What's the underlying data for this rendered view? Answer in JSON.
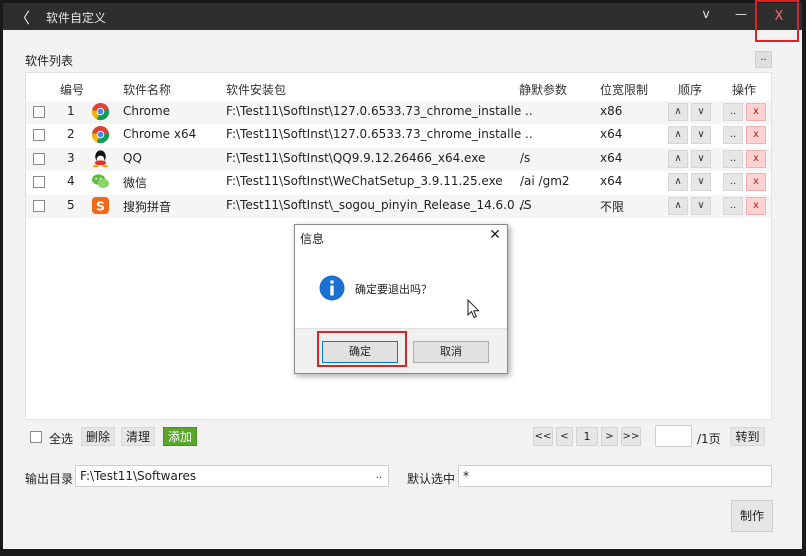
{
  "titlebar": {
    "back": "〈",
    "title": "软件自定义",
    "collapse": "v",
    "minimize": "—",
    "close": "X"
  },
  "list": {
    "title": "软件列表",
    "more": "..",
    "headers": {
      "no": "编号",
      "name": "软件名称",
      "package": "软件安装包",
      "silent": "静默参数",
      "arch": "位宽限制",
      "order": "顺序",
      "ops": "操作"
    },
    "rows": [
      {
        "no": "1",
        "icon": "chrome-icon",
        "name": "Chrome",
        "package": "F:\\Test11\\SoftInst\\127.0.6533.73_chrome_installe ..",
        "silent": "",
        "arch": "x86"
      },
      {
        "no": "2",
        "icon": "chrome-icon",
        "name": "Chrome x64",
        "package": "F:\\Test11\\SoftInst\\127.0.6533.73_chrome_installe ..",
        "silent": "",
        "arch": "x64"
      },
      {
        "no": "3",
        "icon": "qq-icon",
        "name": "QQ",
        "package": "F:\\Test11\\SoftInst\\QQ9.9.12.26466_x64.exe",
        "silent": "/s",
        "arch": "x64"
      },
      {
        "no": "4",
        "icon": "wechat-icon",
        "name": "微信",
        "package": "F:\\Test11\\SoftInst\\WeChatSetup_3.9.11.25.exe",
        "silent": "/ai /gm2",
        "arch": "x64"
      },
      {
        "no": "5",
        "icon": "sogou-icon",
        "name": "搜狗拼音",
        "package": "F:\\Test11\\SoftInst\\_sogou_pinyin_Release_14.6.0 ..",
        "silent": "/S",
        "arch": "不限"
      }
    ],
    "up": "∧",
    "down": "∨",
    "edit": "..",
    "del": "x"
  },
  "footer": {
    "select_all": "全选",
    "delete": "删除",
    "clear": "清理",
    "add": "添加",
    "first": "<<",
    "prev": "<",
    "page": "1",
    "next": ">",
    "last": ">>",
    "total": "/1页",
    "goto": "转到"
  },
  "output": {
    "dir_label": "输出目录",
    "dir_value": "F:\\Test11\\Softwares",
    "browse": "..",
    "default_label": "默认选中",
    "default_value": "*"
  },
  "make": "制作",
  "dialog": {
    "title": "信息",
    "close": "✕",
    "message": "确定要退出吗？",
    "ok": "确定",
    "cancel": "取消"
  },
  "colors": {
    "titlebar": "#2e2e2e",
    "add_button": "#5aa62a",
    "highlight_box": "#d82424",
    "delete_button": "#ffd2d2"
  }
}
